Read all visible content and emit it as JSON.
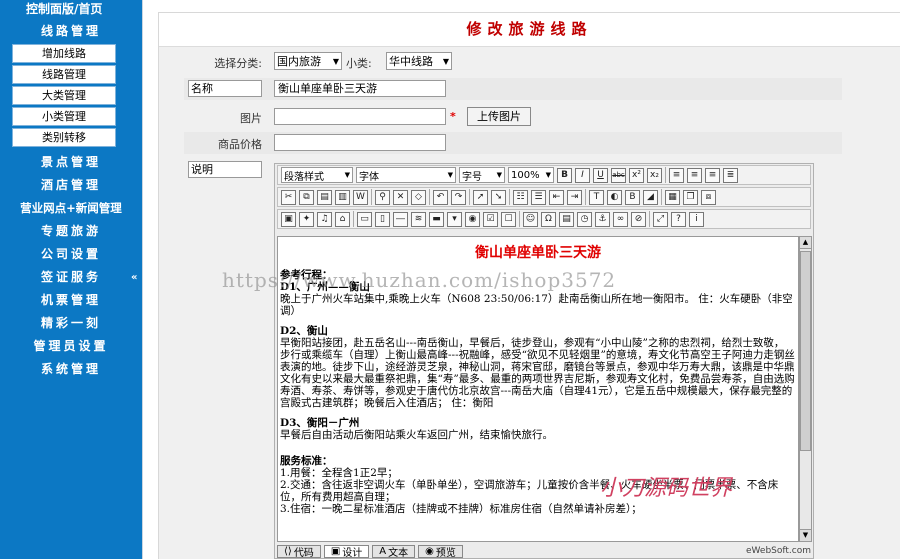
{
  "sidebar": {
    "crumb": "控制面版/首页",
    "sections": [
      {
        "label": "线路管理",
        "items": [
          "增加线路",
          "线路管理",
          "大类管理",
          "小类管理",
          "类别转移"
        ]
      },
      {
        "label": "景点管理"
      },
      {
        "label": "酒店管理"
      },
      {
        "label": "营业网点+新闻管理"
      },
      {
        "label": "专题旅游"
      },
      {
        "label": "公司设置"
      },
      {
        "label": "签证服务"
      },
      {
        "label": "机票管理"
      },
      {
        "label": "精彩一刻"
      },
      {
        "label": "管理员设置"
      },
      {
        "label": "系统管理"
      }
    ],
    "collapse_arrow": "«"
  },
  "page": {
    "title": "修改旅游线路"
  },
  "form": {
    "category_label": "选择分类:",
    "category_value": "国内旅游",
    "subcategory_label": "小类:",
    "subcategory_value": "华中线路",
    "name_label": "名称",
    "name_value": "衡山单座单卧三天游",
    "image_label": "图片",
    "image_value": "",
    "required_mark": "*",
    "upload_button": "上传图片",
    "price_label": "商品价格",
    "price_value": "",
    "desc_label": "说明"
  },
  "editor": {
    "style_select": "段落样式",
    "font_select": "字体",
    "size_select": "字号",
    "zoom_select": "100%",
    "doc_title": "衡山单座单卧三天游",
    "ref_heading": "参考行程：",
    "d1_heading": "D1、广州——衡山",
    "d1_text": "晚上于广州火车站集中,乘晚上火车（N608 23:50/06:17）赴南岳衡山所在地一衡阳市。                                  住：火车硬卧（非空调）",
    "d2_heading": "D2、衡山",
    "d2_text": "早衡阳站接团，赴五岳名山---南岳衡山，早餐后，徒步登山，参观有“小中山陵”之称的忠烈祠，给烈士致敬， 步行或乘缆车（自理）上衡山最高峰---祝融峰，感受“欲见不见轻烟里”的意境，寿文化节高空王子阿迪力走钢丝表演的地。徒步下山，途经游灵芝泉，神秘山洞，蒋宋官邸，磨镜台等景点，参观中华万寿大鼎，该鼎是中华鼎文化有史以来最大最重祭祀鼎，集“寿”最多、最重的两项世界吉尼斯，参观寿文化村，免费品尝寿茶，自由选购寿酒、寿茶、寿饼等，参观史于唐代仿北京故宫---南岳大庙（自理41元），它是五岳中规模最大，保存最完整的宫殿式古建筑群；晚餐后入住酒店；                住：衡阳",
    "d3_heading": "D3、衡阳－广州",
    "d3_text": "早餐后自由活动后衡阳站乘火车返回广州，结束愉快旅行。",
    "service_heading": "服务标准：",
    "service_1": "1.用餐：全程含1正2早；",
    "service_2": "2.交通：含往返非空调火车（单卧单坐），空调旅游车；儿童按价含半餐、火车硬坐半票、门票半票、不含床位，所有费用超高自理；",
    "service_3": "3.住宿：一晚二星标准酒店（挂牌或不挂牌）标准房住宿（自然单请补房差）；",
    "modes": [
      "代码",
      "设计",
      "文本",
      "预览"
    ],
    "active_mode": "设计",
    "brand": "eWebSoft.com"
  },
  "watermark": "https://www.huzhan.com/ishop3572",
  "stamp": "小刀源码世界",
  "colors": {
    "sidebar_bg": "#0c78c4",
    "title_red": "#c00000",
    "doc_title_red": "#e00000"
  }
}
